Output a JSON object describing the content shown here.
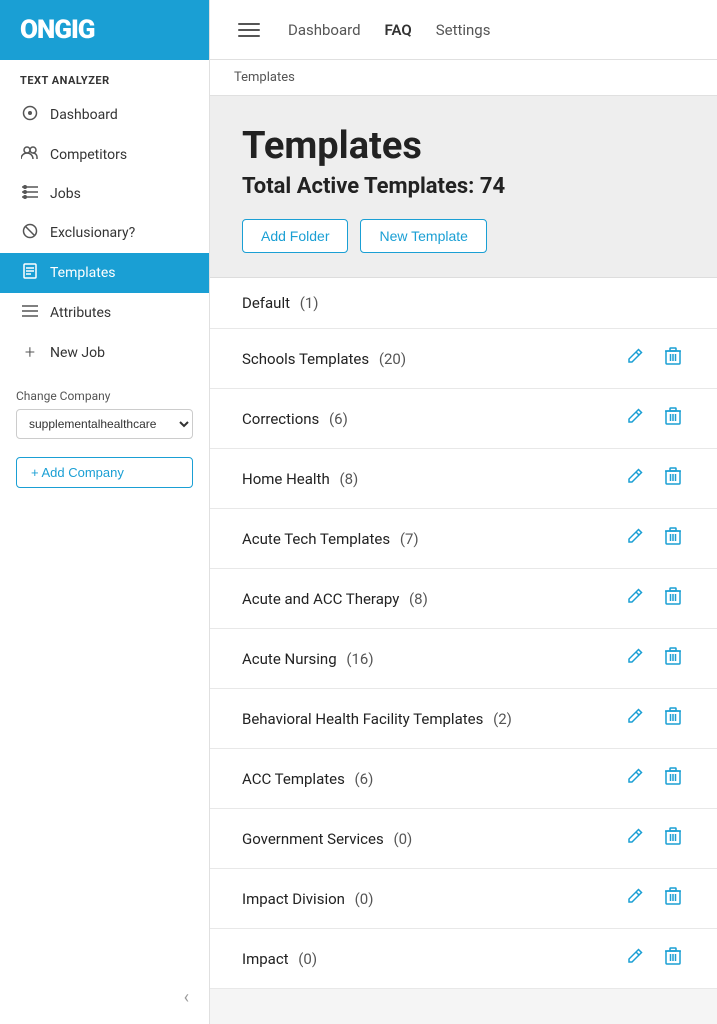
{
  "logo": {
    "text": "ON",
    "text2": "GIG"
  },
  "sidebar": {
    "section_label": "TEXT ANALYZER",
    "items": [
      {
        "id": "dashboard",
        "label": "Dashboard",
        "icon": "⊙",
        "active": false
      },
      {
        "id": "competitors",
        "label": "Competitors",
        "icon": "👥",
        "active": false
      },
      {
        "id": "jobs",
        "label": "Jobs",
        "icon": "☰",
        "active": false
      },
      {
        "id": "exclusionary",
        "label": "Exclusionary?",
        "icon": "⊘",
        "active": false
      },
      {
        "id": "templates",
        "label": "Templates",
        "icon": "📄",
        "active": true
      },
      {
        "id": "attributes",
        "label": "Attributes",
        "icon": "☰",
        "active": false
      }
    ],
    "new_job_label": "New Job",
    "change_company_label": "Change Company",
    "company_value": "supplementalhealthcare",
    "company_options": [
      "supplementalhealthcare"
    ],
    "add_company_label": "+ Add Company",
    "collapse_icon": "‹"
  },
  "topnav": {
    "dashboard_label": "Dashboard",
    "faq_label": "FAQ",
    "settings_label": "Settings"
  },
  "breadcrumb": "Templates",
  "header": {
    "title": "Templates",
    "active_count_label": "Total Active Templates: 74",
    "add_folder_label": "Add Folder",
    "new_template_label": "New Template"
  },
  "templates": [
    {
      "name": "Default",
      "count": "(1)",
      "has_actions": false
    },
    {
      "name": "Schools Templates",
      "count": "(20)",
      "has_actions": true
    },
    {
      "name": "Corrections",
      "count": "(6)",
      "has_actions": true
    },
    {
      "name": "Home Health",
      "count": "(8)",
      "has_actions": true
    },
    {
      "name": "Acute Tech Templates",
      "count": "(7)",
      "has_actions": true
    },
    {
      "name": "Acute and ACC Therapy",
      "count": "(8)",
      "has_actions": true
    },
    {
      "name": "Acute Nursing",
      "count": "(16)",
      "has_actions": true
    },
    {
      "name": "Behavioral Health Facility Templates",
      "count": "(2)",
      "has_actions": true
    },
    {
      "name": "ACC Templates",
      "count": "(6)",
      "has_actions": true
    },
    {
      "name": "Government Services",
      "count": "(0)",
      "has_actions": true
    },
    {
      "name": "Impact Division",
      "count": "(0)",
      "has_actions": true
    },
    {
      "name": "Impact",
      "count": "(0)",
      "has_actions": true
    }
  ]
}
